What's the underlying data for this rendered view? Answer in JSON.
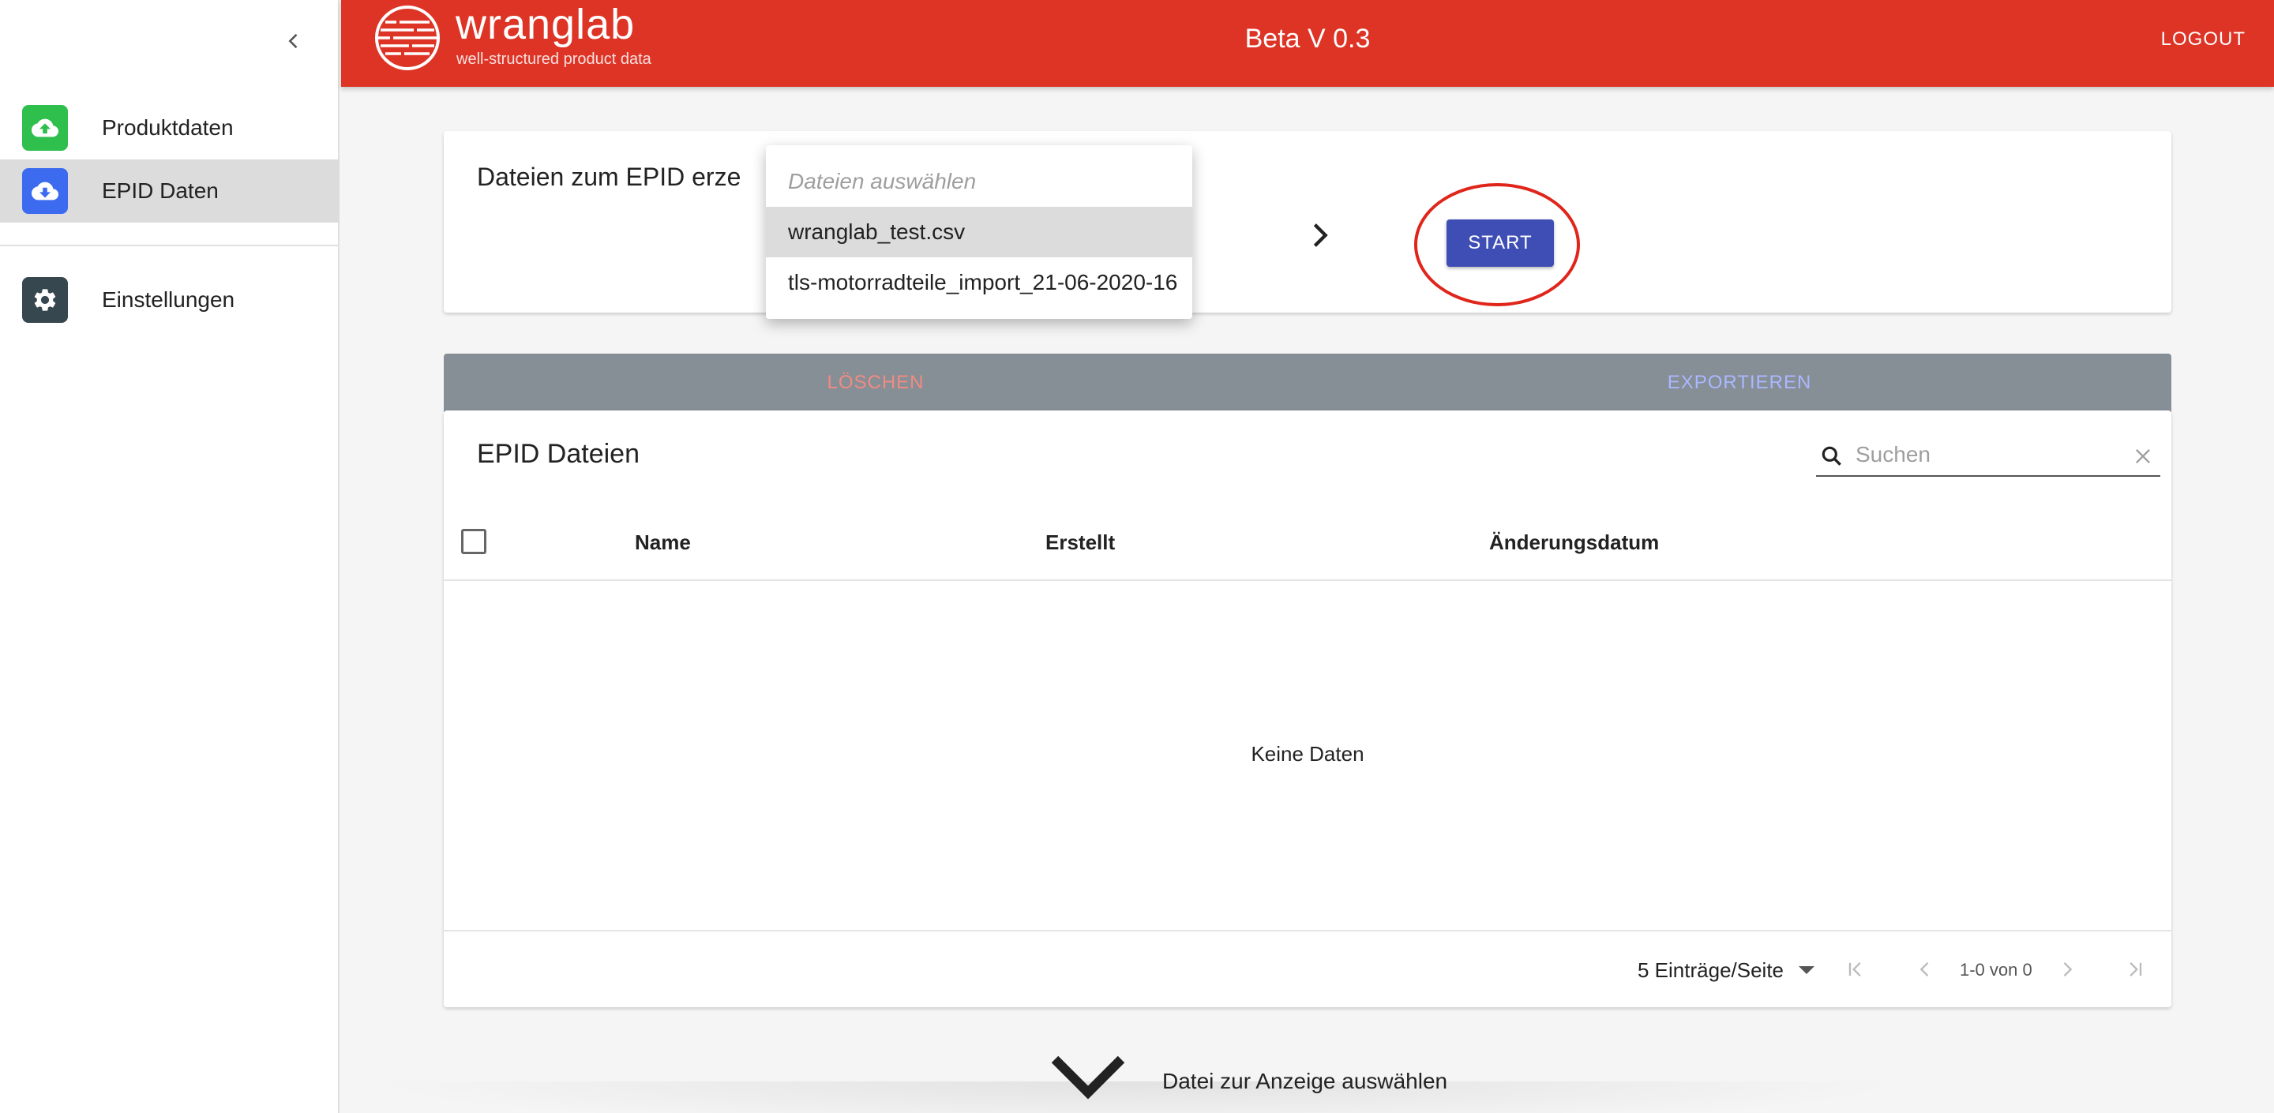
{
  "sidebar": {
    "collapse_icon": "chevron-left-icon",
    "items": [
      {
        "label": "Produktdaten",
        "icon": "cloud-upload-icon",
        "icon_color": "#2fbf4d"
      },
      {
        "label": "EPID Daten",
        "icon": "cloud-download-icon",
        "icon_color": "#3d6bf0",
        "active": true
      },
      {
        "label": "Einstellungen",
        "icon": "gear-icon",
        "icon_color": "#37474f"
      }
    ]
  },
  "header": {
    "brand": "wranglab",
    "tagline": "well-structured product data",
    "version": "Beta V 0.3",
    "logout_label": "LOGOUT",
    "bar_color": "#dd3426"
  },
  "create_card": {
    "title": "Dateien zum EPID erze",
    "start_label": "START",
    "start_color": "#3f4eb5",
    "highlight_color": "#e0251b"
  },
  "dropdown": {
    "placeholder": "Dateien auswählen",
    "options": [
      {
        "label": "wranglab_test.csv",
        "selected": true
      },
      {
        "label": "tls-motorradteile_import_21-06-2020-16",
        "selected": false
      }
    ]
  },
  "tabs": [
    {
      "label": "LÖSCHEN",
      "color": "#f28b82"
    },
    {
      "label": "EXPORTIEREN",
      "color": "#aab8ff"
    }
  ],
  "table": {
    "title": "EPID Dateien",
    "search_placeholder": "Suchen",
    "columns": [
      "Name",
      "Erstellt",
      "Änderungsdatum"
    ],
    "rows": [],
    "empty_message": "Keine Daten",
    "rows_per_page": "5 Einträge/Seite",
    "range": "1-0 von 0"
  },
  "footer": {
    "select_label": "Datei zur Anzeige auswählen"
  }
}
